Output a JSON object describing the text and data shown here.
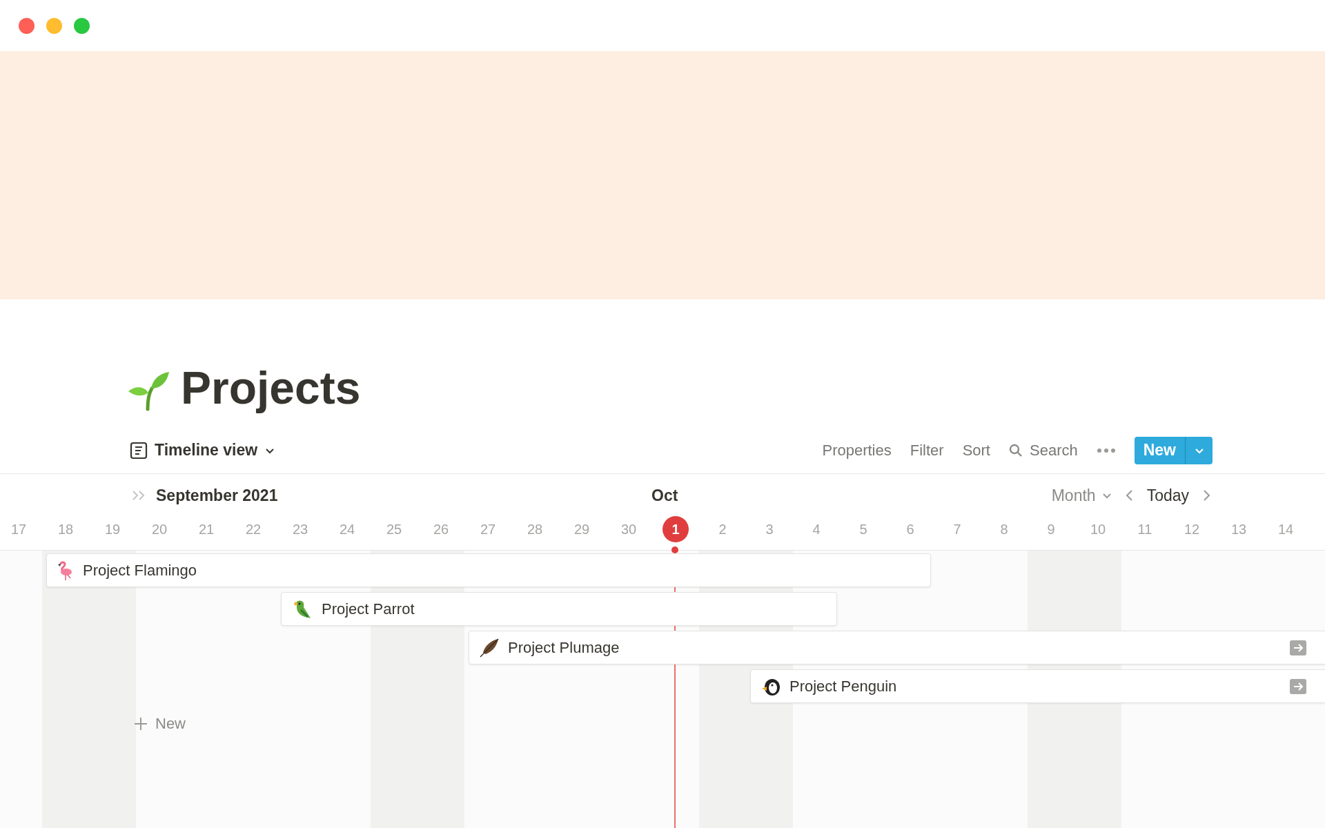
{
  "page": {
    "title": "Projects"
  },
  "toolbar": {
    "view": "Timeline view",
    "actions": [
      "Properties",
      "Filter",
      "Sort"
    ],
    "search": "Search",
    "new_button": "New"
  },
  "timeline": {
    "month": "September 2021",
    "next_month": "Oct",
    "scale": "Month",
    "today_button": "Today",
    "days": [
      {
        "label": "17",
        "weekend": false,
        "today": false
      },
      {
        "label": "18",
        "weekend": true,
        "today": false
      },
      {
        "label": "19",
        "weekend": true,
        "today": false
      },
      {
        "label": "20",
        "weekend": false,
        "today": false
      },
      {
        "label": "21",
        "weekend": false,
        "today": false
      },
      {
        "label": "22",
        "weekend": false,
        "today": false
      },
      {
        "label": "23",
        "weekend": false,
        "today": false
      },
      {
        "label": "24",
        "weekend": false,
        "today": false
      },
      {
        "label": "25",
        "weekend": true,
        "today": false
      },
      {
        "label": "26",
        "weekend": true,
        "today": false
      },
      {
        "label": "27",
        "weekend": false,
        "today": false
      },
      {
        "label": "28",
        "weekend": false,
        "today": false
      },
      {
        "label": "29",
        "weekend": false,
        "today": false
      },
      {
        "label": "30",
        "weekend": false,
        "today": false
      },
      {
        "label": "1",
        "weekend": false,
        "today": true
      },
      {
        "label": "2",
        "weekend": true,
        "today": false
      },
      {
        "label": "3",
        "weekend": true,
        "today": false
      },
      {
        "label": "4",
        "weekend": false,
        "today": false
      },
      {
        "label": "5",
        "weekend": false,
        "today": false
      },
      {
        "label": "6",
        "weekend": false,
        "today": false
      },
      {
        "label": "7",
        "weekend": false,
        "today": false
      },
      {
        "label": "8",
        "weekend": false,
        "today": false
      },
      {
        "label": "9",
        "weekend": true,
        "today": false
      },
      {
        "label": "10",
        "weekend": true,
        "today": false
      },
      {
        "label": "11",
        "weekend": false,
        "today": false
      },
      {
        "label": "12",
        "weekend": false,
        "today": false
      },
      {
        "label": "13",
        "weekend": false,
        "today": false
      },
      {
        "label": "14",
        "weekend": false,
        "today": false
      }
    ],
    "items": [
      {
        "name": "Project Flamingo",
        "continues_right": false
      },
      {
        "name": "Project Parrot",
        "continues_right": false
      },
      {
        "name": "Project Plumage",
        "continues_right": true
      },
      {
        "name": "Project Penguin",
        "continues_right": true
      }
    ],
    "add_label": "New"
  }
}
